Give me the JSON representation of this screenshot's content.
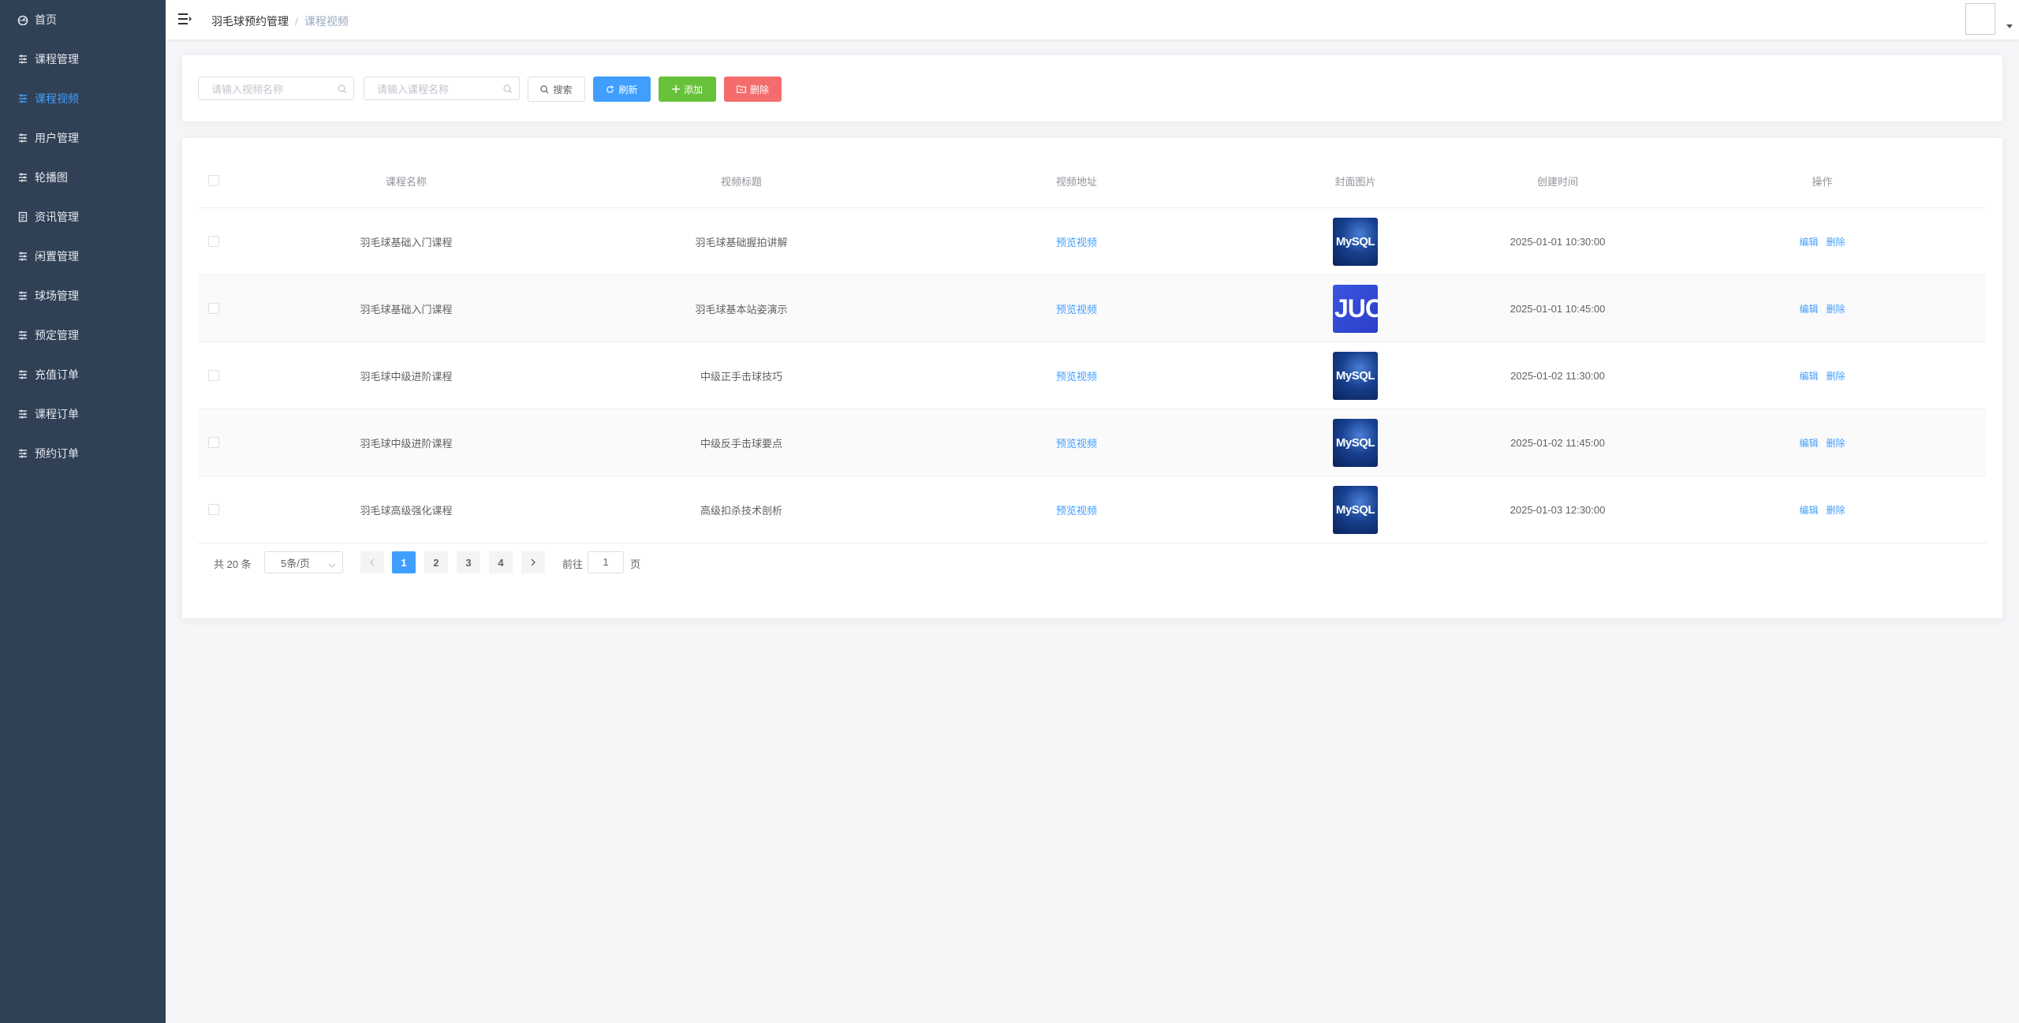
{
  "sidebar": {
    "items": [
      {
        "label": "首页",
        "icon": "dashboard-icon",
        "active": false
      },
      {
        "label": "课程管理",
        "icon": "sliders-icon",
        "active": false
      },
      {
        "label": "课程视频",
        "icon": "sliders-icon",
        "active": true
      },
      {
        "label": "用户管理",
        "icon": "sliders-icon",
        "active": false
      },
      {
        "label": "轮播图",
        "icon": "sliders-icon",
        "active": false
      },
      {
        "label": "资讯管理",
        "icon": "document-icon",
        "active": false
      },
      {
        "label": "闲置管理",
        "icon": "sliders-icon",
        "active": false
      },
      {
        "label": "球场管理",
        "icon": "sliders-icon",
        "active": false
      },
      {
        "label": "预定管理",
        "icon": "sliders-icon",
        "active": false
      },
      {
        "label": "充值订单",
        "icon": "sliders-icon",
        "active": false
      },
      {
        "label": "课程订单",
        "icon": "sliders-icon",
        "active": false
      },
      {
        "label": "预约订单",
        "icon": "sliders-icon",
        "active": false
      }
    ]
  },
  "header": {
    "breadcrumb_root": "羽毛球预约管理",
    "breadcrumb_separator": "/",
    "breadcrumb_current": "课程视频"
  },
  "toolbar": {
    "video_name_placeholder": "请输入视频名称",
    "course_name_placeholder": "请输入课程名称",
    "search_label": "搜索",
    "refresh_label": "刷新",
    "add_label": "添加",
    "delete_label": "删除"
  },
  "table": {
    "headers": {
      "course_name": "课程名称",
      "video_title": "视频标题",
      "video_url": "视频地址",
      "cover_image": "封面图片",
      "created_time": "创建时间",
      "actions": "操作"
    },
    "rows": [
      {
        "course_name": "羽毛球基础入门课程",
        "video_title": "羽毛球基础握拍讲解",
        "video_link": "预览视频",
        "cover_text": "MySQL",
        "cover_style": "mysql",
        "created_time": "2025-01-01 10:30:00",
        "edit": "编辑",
        "delete": "删除"
      },
      {
        "course_name": "羽毛球基础入门课程",
        "video_title": "羽毛球基本站姿演示",
        "video_link": "预览视频",
        "cover_text": "JUC",
        "cover_style": "juc",
        "created_time": "2025-01-01 10:45:00",
        "edit": "编辑",
        "delete": "删除"
      },
      {
        "course_name": "羽毛球中级进阶课程",
        "video_title": "中级正手击球技巧",
        "video_link": "预览视频",
        "cover_text": "MySQL",
        "cover_style": "mysql",
        "created_time": "2025-01-02 11:30:00",
        "edit": "编辑",
        "delete": "删除"
      },
      {
        "course_name": "羽毛球中级进阶课程",
        "video_title": "中级反手击球要点",
        "video_link": "预览视频",
        "cover_text": "MySQL",
        "cover_style": "mysql",
        "created_time": "2025-01-02 11:45:00",
        "edit": "编辑",
        "delete": "删除"
      },
      {
        "course_name": "羽毛球高级强化课程",
        "video_title": "高级扣杀技术剖析",
        "video_link": "预览视频",
        "cover_text": "MySQL",
        "cover_style": "mysql",
        "created_time": "2025-01-03 12:30:00",
        "edit": "编辑",
        "delete": "删除"
      }
    ]
  },
  "pagination": {
    "total_label": "共 20 条",
    "page_size": "5条/页",
    "pages": [
      "1",
      "2",
      "3",
      "4"
    ],
    "current_page": "1",
    "goto_prefix": "前往",
    "goto_value": "1",
    "goto_suffix": "页"
  },
  "colors": {
    "sidebar_bg": "#304156",
    "active": "#409eff",
    "success": "#67c23a",
    "danger": "#f56c6c"
  }
}
